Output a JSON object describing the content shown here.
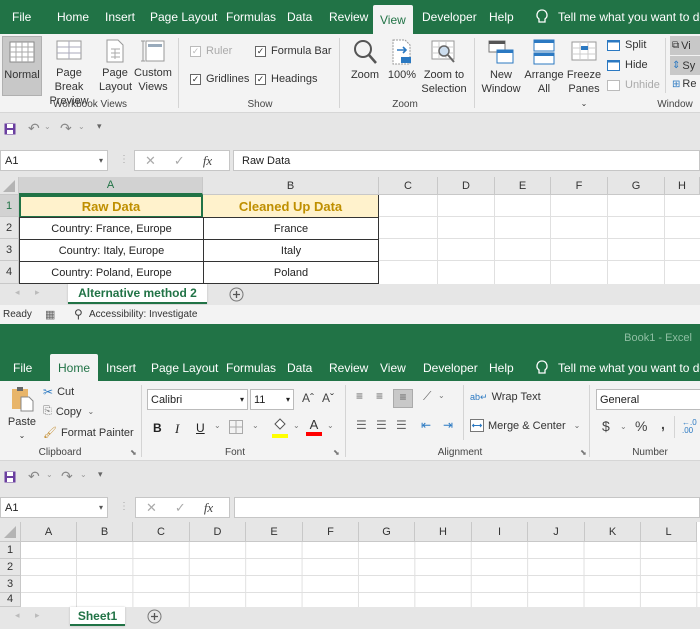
{
  "top": {
    "tabs": [
      {
        "label": "File"
      },
      {
        "label": "Home"
      },
      {
        "label": "Insert"
      },
      {
        "label": "Page Layout"
      },
      {
        "label": "Formulas"
      },
      {
        "label": "Data"
      },
      {
        "label": "Review"
      },
      {
        "label": "View",
        "active": true
      },
      {
        "label": "Developer"
      },
      {
        "label": "Help"
      }
    ],
    "tell_me": "Tell me what you want to do",
    "ribbon": {
      "workbook_views": {
        "label": "Workbook Views",
        "buttons": [
          {
            "label1": "Normal",
            "label2": "",
            "active": true
          },
          {
            "label1": "Page Break",
            "label2": "Preview"
          },
          {
            "label1": "Page",
            "label2": "Layout"
          },
          {
            "label1": "Custom",
            "label2": "Views"
          }
        ]
      },
      "show": {
        "label": "Show",
        "ruler": {
          "label": "Ruler",
          "checked": true,
          "disabled": true
        },
        "formula_bar": {
          "label": "Formula Bar",
          "checked": true
        },
        "gridlines": {
          "label": "Gridlines",
          "checked": true
        },
        "headings": {
          "label": "Headings",
          "checked": true
        }
      },
      "zoom": {
        "label": "Zoom",
        "zoom": "Zoom",
        "hundred": "100%",
        "zoom_sel1": "Zoom to",
        "zoom_sel2": "Selection"
      },
      "window": {
        "label": "Window",
        "new_window1": "New",
        "new_window2": "Window",
        "arrange1": "Arrange",
        "arrange2": "All",
        "freeze1": "Freeze",
        "freeze2": "Panes",
        "split": "Split",
        "hide": "Hide",
        "unhide": "Unhide",
        "view_side": "Vi",
        "sync": "Sy",
        "reset": "Re"
      }
    },
    "name_box": "A1",
    "formula": "Raw Data",
    "columns": [
      "A",
      "B",
      "C",
      "D",
      "E",
      "F",
      "G",
      "H"
    ],
    "rows": [
      "1",
      "2",
      "3",
      "4"
    ],
    "cells": [
      [
        "Raw Data",
        "Cleaned Up Data"
      ],
      [
        "Country: France, Europe",
        "France"
      ],
      [
        "Country: Italy, Europe",
        "Italy"
      ],
      [
        "Country: Poland, Europe",
        "Poland"
      ]
    ],
    "sheet_tab": "Alternative method 2",
    "status": {
      "ready": "Ready",
      "accessibility": "Accessibility: Investigate"
    }
  },
  "bottom": {
    "title": "Book1  -  Excel",
    "tabs": [
      {
        "label": "File"
      },
      {
        "label": "Home",
        "active": true
      },
      {
        "label": "Insert"
      },
      {
        "label": "Page Layout"
      },
      {
        "label": "Formulas"
      },
      {
        "label": "Data"
      },
      {
        "label": "Review"
      },
      {
        "label": "View"
      },
      {
        "label": "Developer"
      },
      {
        "label": "Help"
      }
    ],
    "tell_me": "Tell me what you want to do",
    "ribbon": {
      "clipboard": {
        "label": "Clipboard",
        "paste": "Paste",
        "cut": "Cut",
        "copy": "Copy",
        "format_painter": "Format Painter"
      },
      "font": {
        "label": "Font",
        "font_name": "Calibri",
        "font_size": "11",
        "bold": "B",
        "italic": "I",
        "underline": "U",
        "highlight_color": "#ffff00",
        "font_color": "#ff0000"
      },
      "alignment": {
        "label": "Alignment",
        "wrap_text": "Wrap Text",
        "merge_center": "Merge & Center"
      },
      "number": {
        "label": "Number",
        "format": "General",
        "currency": "$",
        "percent": "%",
        "comma": ","
      }
    },
    "name_box": "A1",
    "formula": "",
    "columns": [
      "A",
      "B",
      "C",
      "D",
      "E",
      "F",
      "G",
      "H",
      "I",
      "J",
      "K",
      "L"
    ],
    "rows": [
      "1",
      "2",
      "3",
      "4"
    ],
    "sheet_tab": "Sheet1"
  },
  "colors": {
    "excel_green": "#217346",
    "header_fill": "#fff2cc",
    "header_text": "#bf8f00"
  }
}
